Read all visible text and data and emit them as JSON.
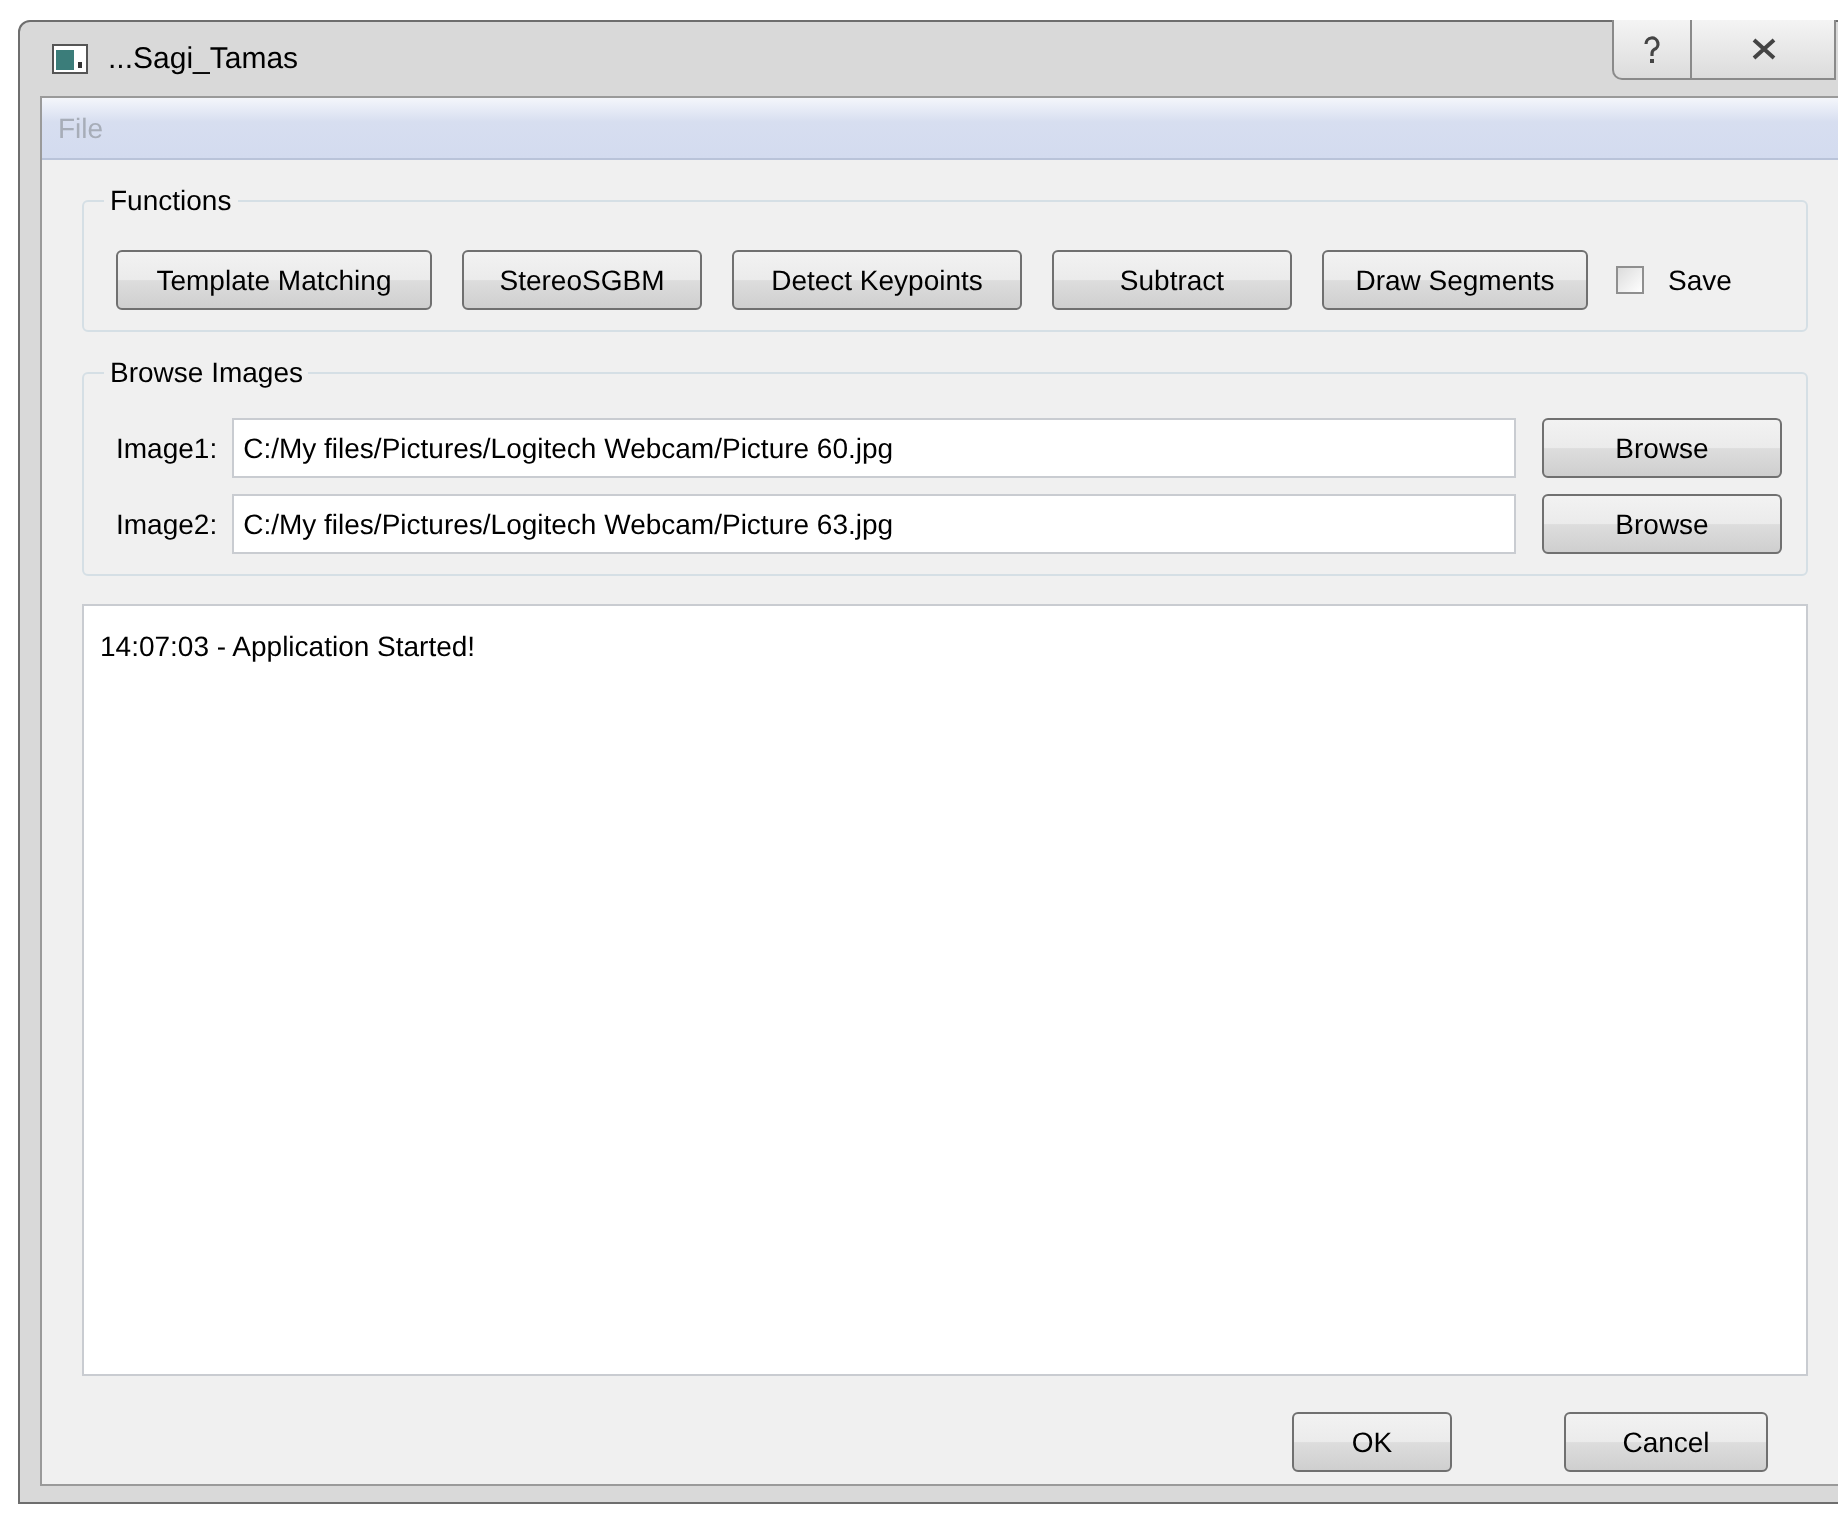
{
  "window": {
    "title": "...Sagi_Tamas"
  },
  "menu": [
    {
      "label": "File",
      "disabled": true
    }
  ],
  "functions": {
    "title": "Functions",
    "buttons": [
      "Template Matching",
      "StereoSGBM",
      "Detect Keypoints",
      "Subtract",
      "Draw Segments"
    ],
    "save": {
      "label": "Save",
      "checked": false
    }
  },
  "browse": {
    "title": "Browse Images",
    "rows": [
      {
        "label": "Image1:",
        "value": "C:/My files/Pictures/Logitech Webcam/Picture 60.jpg",
        "button": "Browse"
      },
      {
        "label": "Image2:",
        "value": "C:/My files/Pictures/Logitech Webcam/Picture 63.jpg",
        "button": "Browse"
      }
    ]
  },
  "log": {
    "lines": [
      "14:07:03 - Application Started!"
    ]
  },
  "buttons": [
    "OK",
    "Cancel"
  ]
}
